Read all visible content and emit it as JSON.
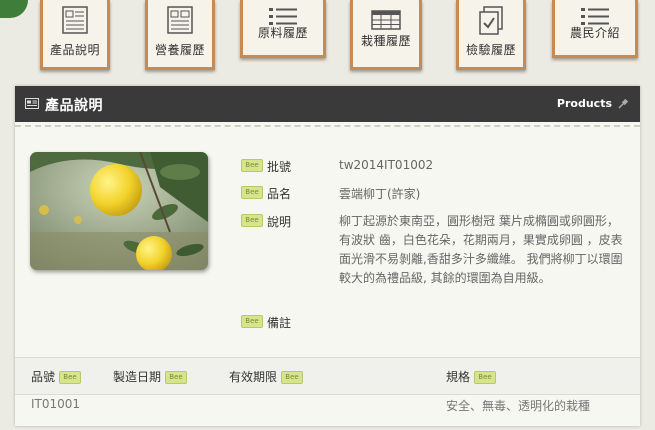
{
  "nav": {
    "cards": [
      {
        "label": "產品說明",
        "icon": "product-info-icon"
      },
      {
        "label": "營養履歷",
        "icon": "nutrition-icon"
      },
      {
        "label": "原料履歷",
        "icon": "materials-list-icon"
      },
      {
        "label": "栽種履歷",
        "icon": "planting-table-icon"
      },
      {
        "label": "檢驗履歷",
        "icon": "inspection-documents-icon"
      },
      {
        "label": "農民介紹",
        "icon": "farmer-intro-icon"
      }
    ]
  },
  "panel": {
    "title": "產品說明",
    "products_link": "Products",
    "badge_text": "Bee",
    "fields": {
      "batch": {
        "label": "批號",
        "value": "tw2014IT01002"
      },
      "name": {
        "label": "品名",
        "value": "雲端柳丁(許家)"
      },
      "desc": {
        "label": "說明",
        "value": "柳丁起源於東南亞，圓形樹冠 葉片成橢圓或卵圓形，有波狀 齒，白色花朵，花期兩月，果實成卵圓 ，皮表面光滑不易剝離,香甜多汁多纖維。 我們將柳丁以環圍較大的為禮品級, 其餘的環圍為自用級。"
      },
      "note": {
        "label": "備註",
        "value": ""
      }
    },
    "table": {
      "headers": [
        "品號",
        "製造日期",
        "有效期限",
        "規格"
      ],
      "row": [
        "IT01001",
        "",
        "",
        "安全、無毒、透明化的栽種"
      ]
    }
  },
  "colors": {
    "header_bg": "#3a3a3a",
    "card_border": "#c98a52",
    "badge": "#d6e58a"
  }
}
